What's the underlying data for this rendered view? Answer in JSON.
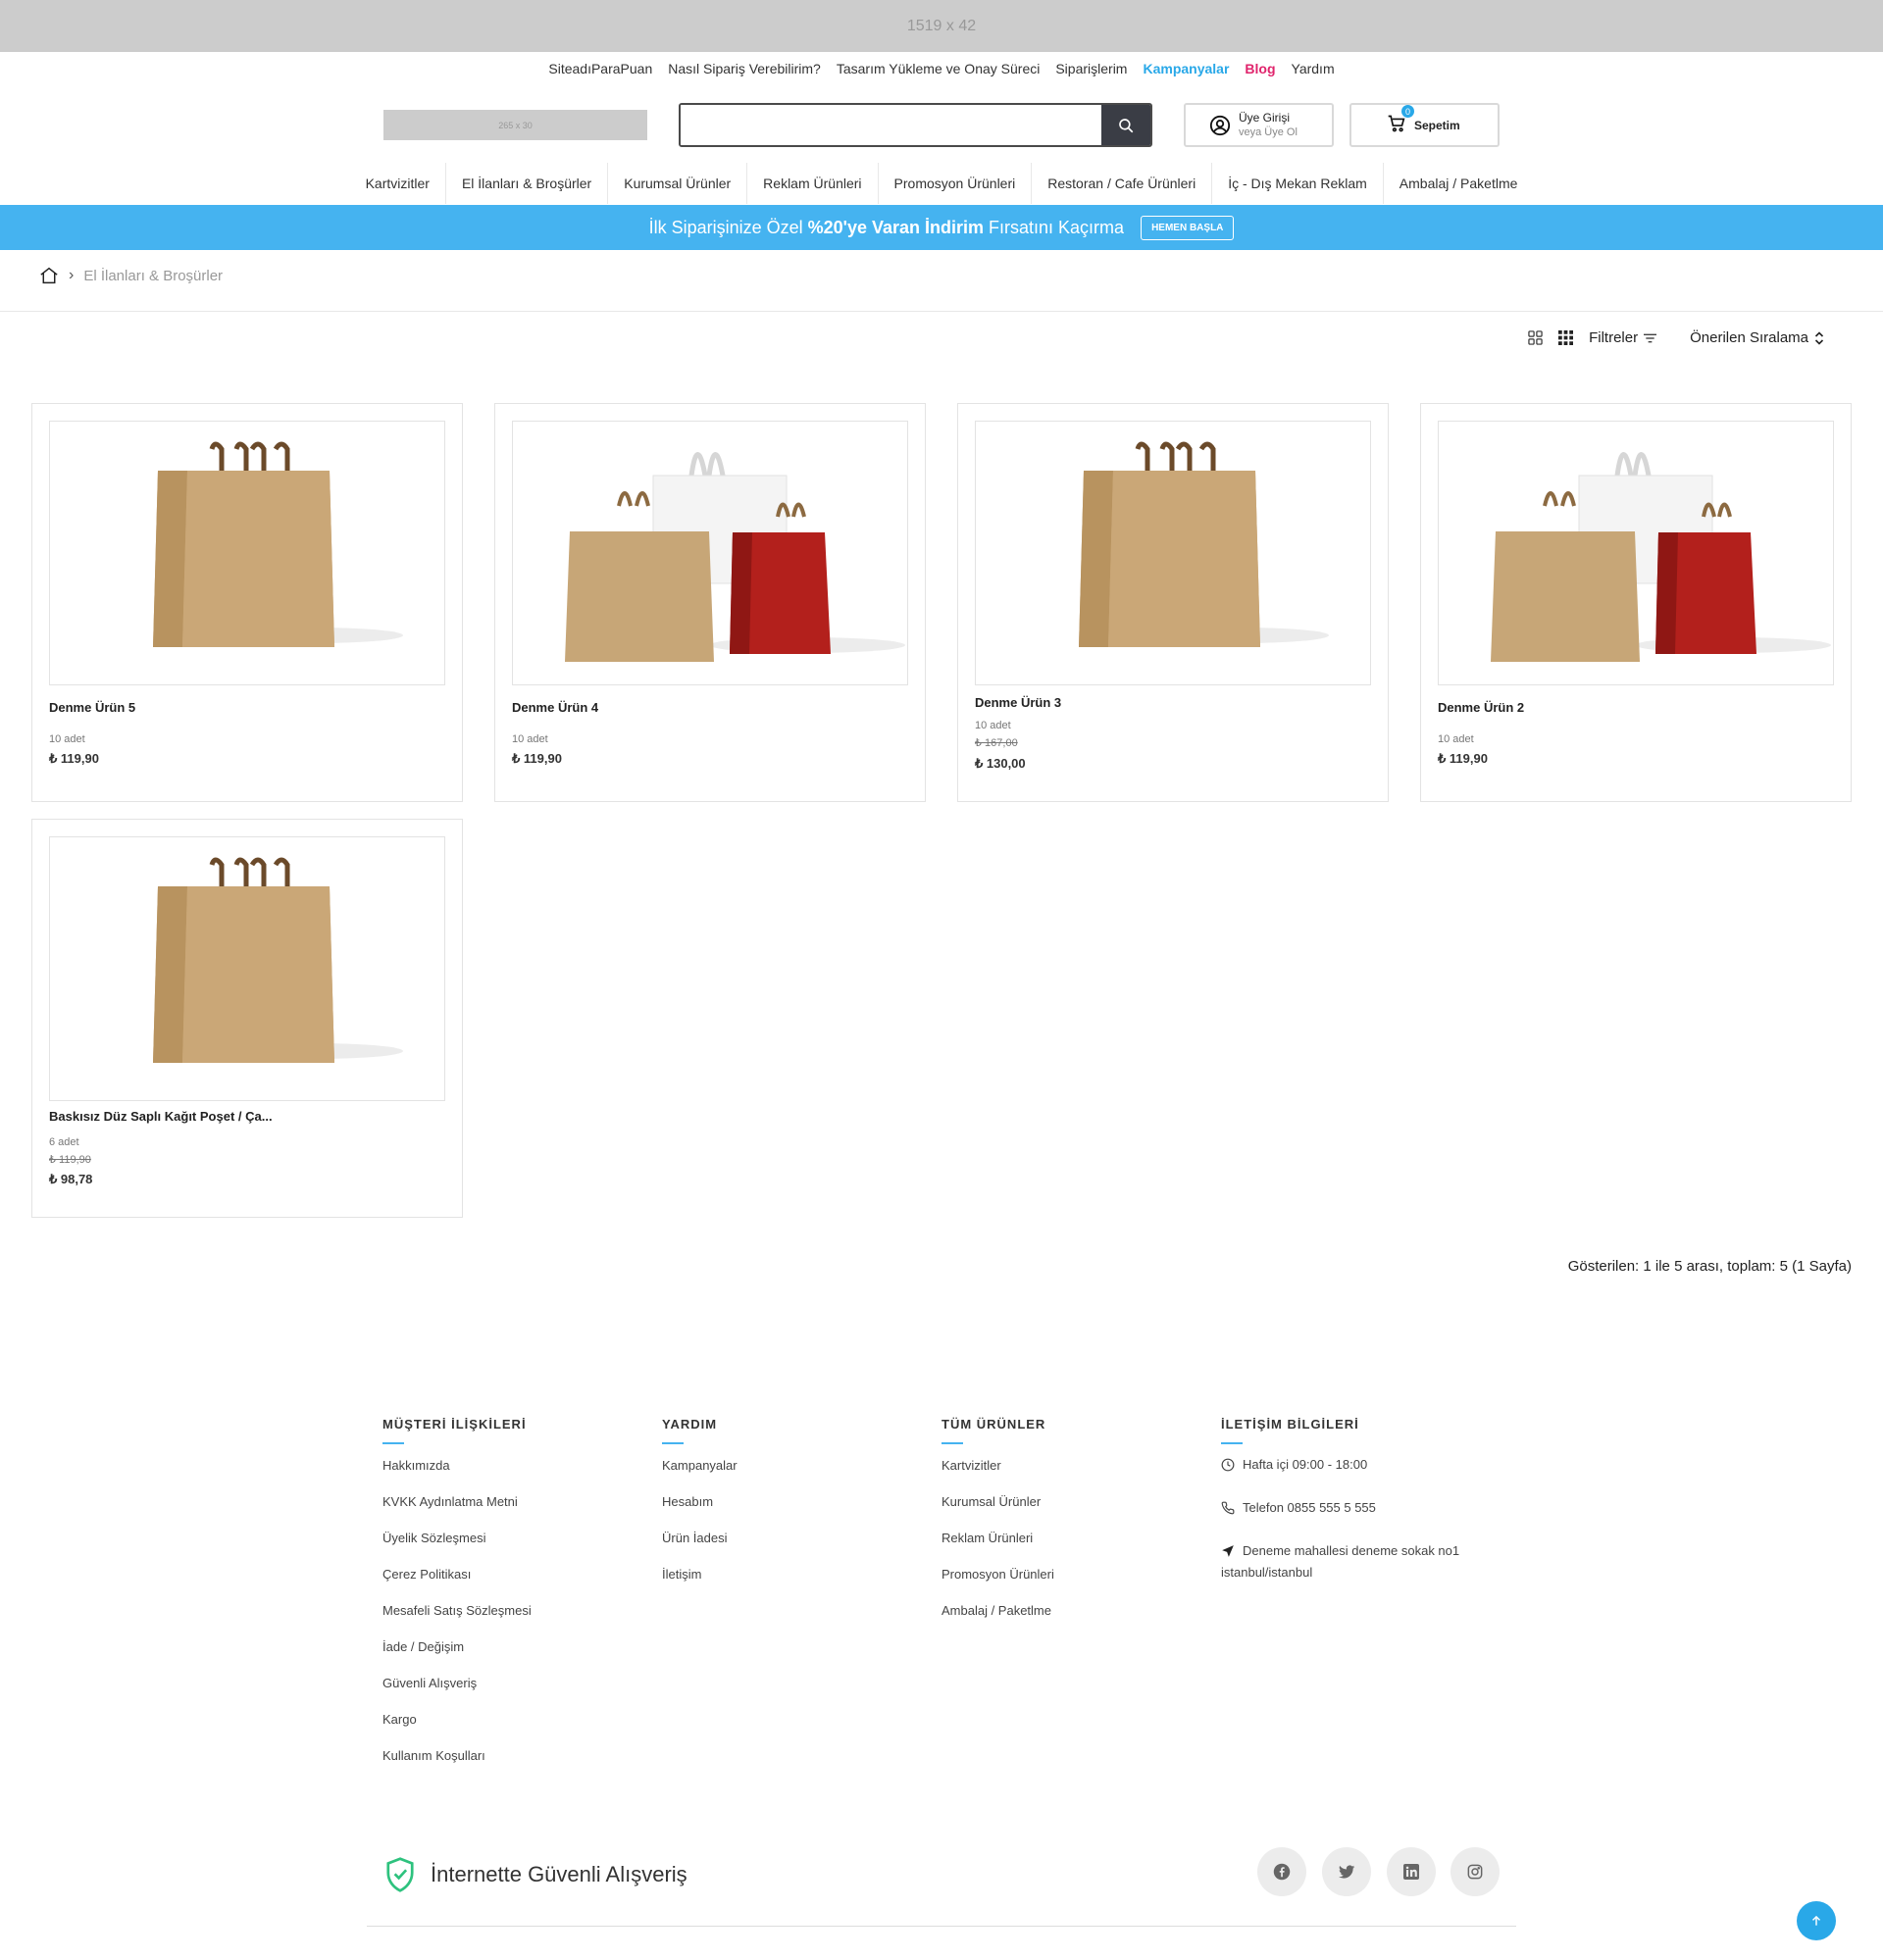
{
  "top_banner": {
    "placeholder": "1519 x 42"
  },
  "top_links": [
    {
      "label": "SiteadıParaPuan"
    },
    {
      "label": "Nasıl Sipariş Verebilirim?"
    },
    {
      "label": "Tasarım Yükleme ve Onay Süreci"
    },
    {
      "label": "Siparişlerim"
    },
    {
      "label": "Kampanyalar"
    },
    {
      "label": "Blog"
    },
    {
      "label": "Yardım"
    }
  ],
  "logo": {
    "placeholder": "265 x 30"
  },
  "search": {
    "value": "",
    "placeholder": ""
  },
  "login": {
    "line1": "Üye Girişi",
    "line2": "veya Üye Ol"
  },
  "cart": {
    "label": "Sepetim",
    "count": "0"
  },
  "categories": [
    "Kartvizitler",
    "El İlanları & Broşürler",
    "Kurumsal Ürünler",
    "Reklam Ürünleri",
    "Promosyon Ürünleri",
    "Restoran / Cafe Ürünleri",
    "İç - Dış Mekan Reklam",
    "Ambalaj / Paketlme"
  ],
  "promo": {
    "pre": "İlk Siparişinize Özel",
    "bold": "%20'ye Varan İndirim",
    "post": "Fırsatını Kaçırma",
    "button": "HEMEN BAŞLA"
  },
  "breadcrumb": {
    "current": "El İlanları & Broşürler"
  },
  "toolbar": {
    "filters": "Filtreler",
    "sort": "Önerilen Sıralama"
  },
  "products": [
    {
      "name": "Denme Ürün 5",
      "qty": "10 adet",
      "old_price": "",
      "price": "₺ 119,90",
      "image": "single-kraft-bag"
    },
    {
      "name": "Denme Ürün 4",
      "qty": "10 adet",
      "old_price": "",
      "price": "₺ 119,90",
      "image": "three-bags"
    },
    {
      "name": "Denme Ürün 3",
      "qty": "10 adet",
      "old_price": "₺ 167,00",
      "price": "₺ 130,00",
      "image": "single-kraft-bag"
    },
    {
      "name": "Denme Ürün 2",
      "qty": "10 adet",
      "old_price": "",
      "price": "₺ 119,90",
      "image": "three-bags"
    },
    {
      "name": "Baskısız Düz Saplı Kağıt Poşet / Ça...",
      "qty": "6 adet",
      "old_price": "₺ 119,90",
      "price": "₺ 98,78",
      "image": "single-kraft-bag"
    }
  ],
  "results": "Gösterilen: 1 ile 5 arası, toplam: 5 (1 Sayfa)",
  "footer": {
    "customer": {
      "title": "MÜŞTERİ İLİŞKİLERİ",
      "links": [
        "Hakkımızda",
        "KVKK Aydınlatma Metni",
        "Üyelik Sözleşmesi",
        "Çerez Politikası",
        "Mesafeli Satış Sözleşmesi",
        "İade / Değişim",
        "Güvenli Alışveriş",
        "Kargo",
        "Kullanım Koşulları"
      ]
    },
    "help": {
      "title": "YARDIM",
      "links": [
        "Kampanyalar",
        "Hesabım",
        "Ürün İadesi",
        "İletişim"
      ]
    },
    "products": {
      "title": "TÜM ÜRÜNLER",
      "links": [
        "Kartvizitler",
        "Kurumsal Ürünler",
        "Reklam Ürünleri",
        "Promosyon Ürünleri",
        "Ambalaj / Paketlme"
      ]
    },
    "contact": {
      "title": "İLETİŞİM BİLGİLERİ",
      "hours": "Hafta içi 09:00 - 18:00",
      "phone": "Telefon 0855 555 5 555",
      "address": "Deneme mahallesi deneme sokak no1 istanbul/istanbul"
    },
    "secure": "İnternette Güvenli Alışveriş",
    "social": [
      "facebook-icon",
      "twitter-icon",
      "linkedin-icon",
      "instagram-icon"
    ]
  },
  "colors": {
    "accent": "#29a8e8",
    "promo_bg": "#45b3f0",
    "blog": "#e0246c",
    "search_btn": "#3a3d45"
  }
}
